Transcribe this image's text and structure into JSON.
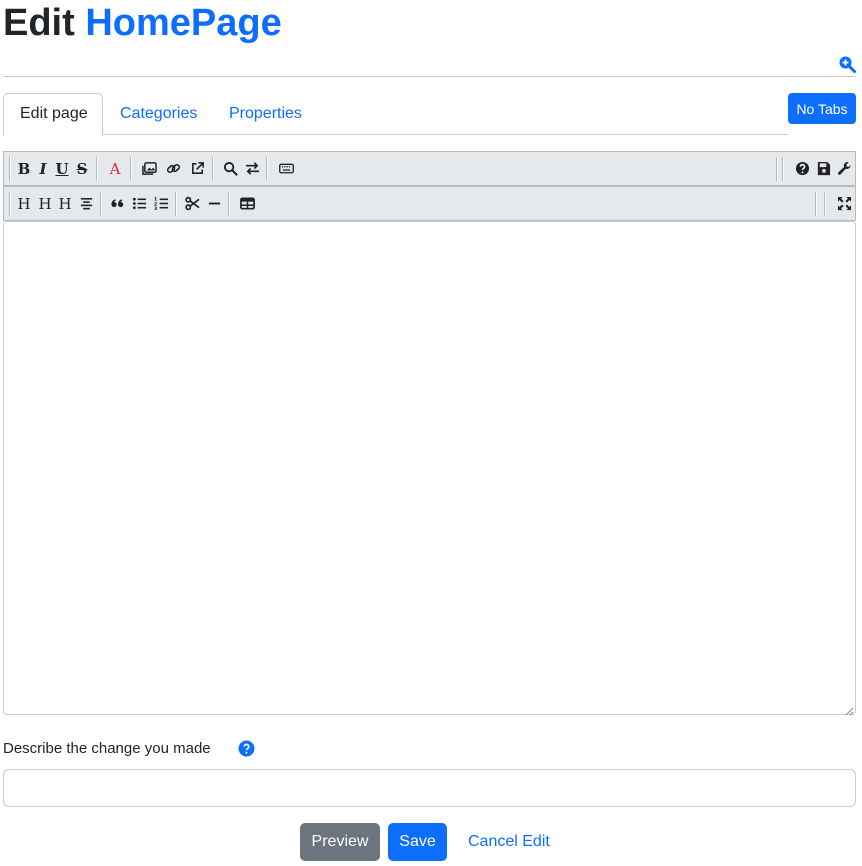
{
  "header": {
    "title_prefix": "Edit",
    "page_name": "HomePage",
    "zoom_icon": "zoom-in-icon"
  },
  "tabs": [
    {
      "label": "Edit page",
      "active": true
    },
    {
      "label": "Categories",
      "active": false
    },
    {
      "label": "Properties",
      "active": false
    }
  ],
  "no_tabs_label": "No Tabs",
  "toolbar1": {
    "format": [
      {
        "text": "B",
        "icon": "bold-icon"
      },
      {
        "text": "I",
        "icon": "italic-icon"
      },
      {
        "text": "U",
        "icon": "underline-icon"
      },
      {
        "text": "S",
        "icon": "strikethrough-icon"
      }
    ],
    "color_text": "A",
    "color_icon": "text-color-icon",
    "color": "#d9263b",
    "media": [
      "image-icon",
      "link-icon",
      "external-link-icon"
    ],
    "search": [
      "search-icon",
      "replace-icon"
    ],
    "keyboard": "keyboard-icon",
    "right": [
      "help-icon",
      "save-icon",
      "wrench-icon"
    ]
  },
  "toolbar2": {
    "headings": [
      {
        "text": "H",
        "icon": "heading-1-icon"
      },
      {
        "text": "H",
        "icon": "heading-2-icon"
      },
      {
        "text": "H",
        "icon": "heading-3-icon"
      }
    ],
    "align": "align-center-icon",
    "lists": [
      "blockquote-icon",
      "bullet-list-icon",
      "numbered-list-icon"
    ],
    "tools": [
      "cut-icon",
      "horizontal-rule-icon"
    ],
    "table": "table-icon",
    "right": "fullscreen-icon"
  },
  "editor": {
    "value": ""
  },
  "summary": {
    "label": "Describe the change you made",
    "help_icon": "question-circle-icon",
    "value": "",
    "placeholder": ""
  },
  "actions": {
    "preview": "Preview",
    "save": "Save",
    "cancel": "Cancel Edit"
  },
  "colors": {
    "accent": "#0d6efd",
    "secondary": "#6c757d",
    "toolbar_bg": "#e6e9ec"
  }
}
